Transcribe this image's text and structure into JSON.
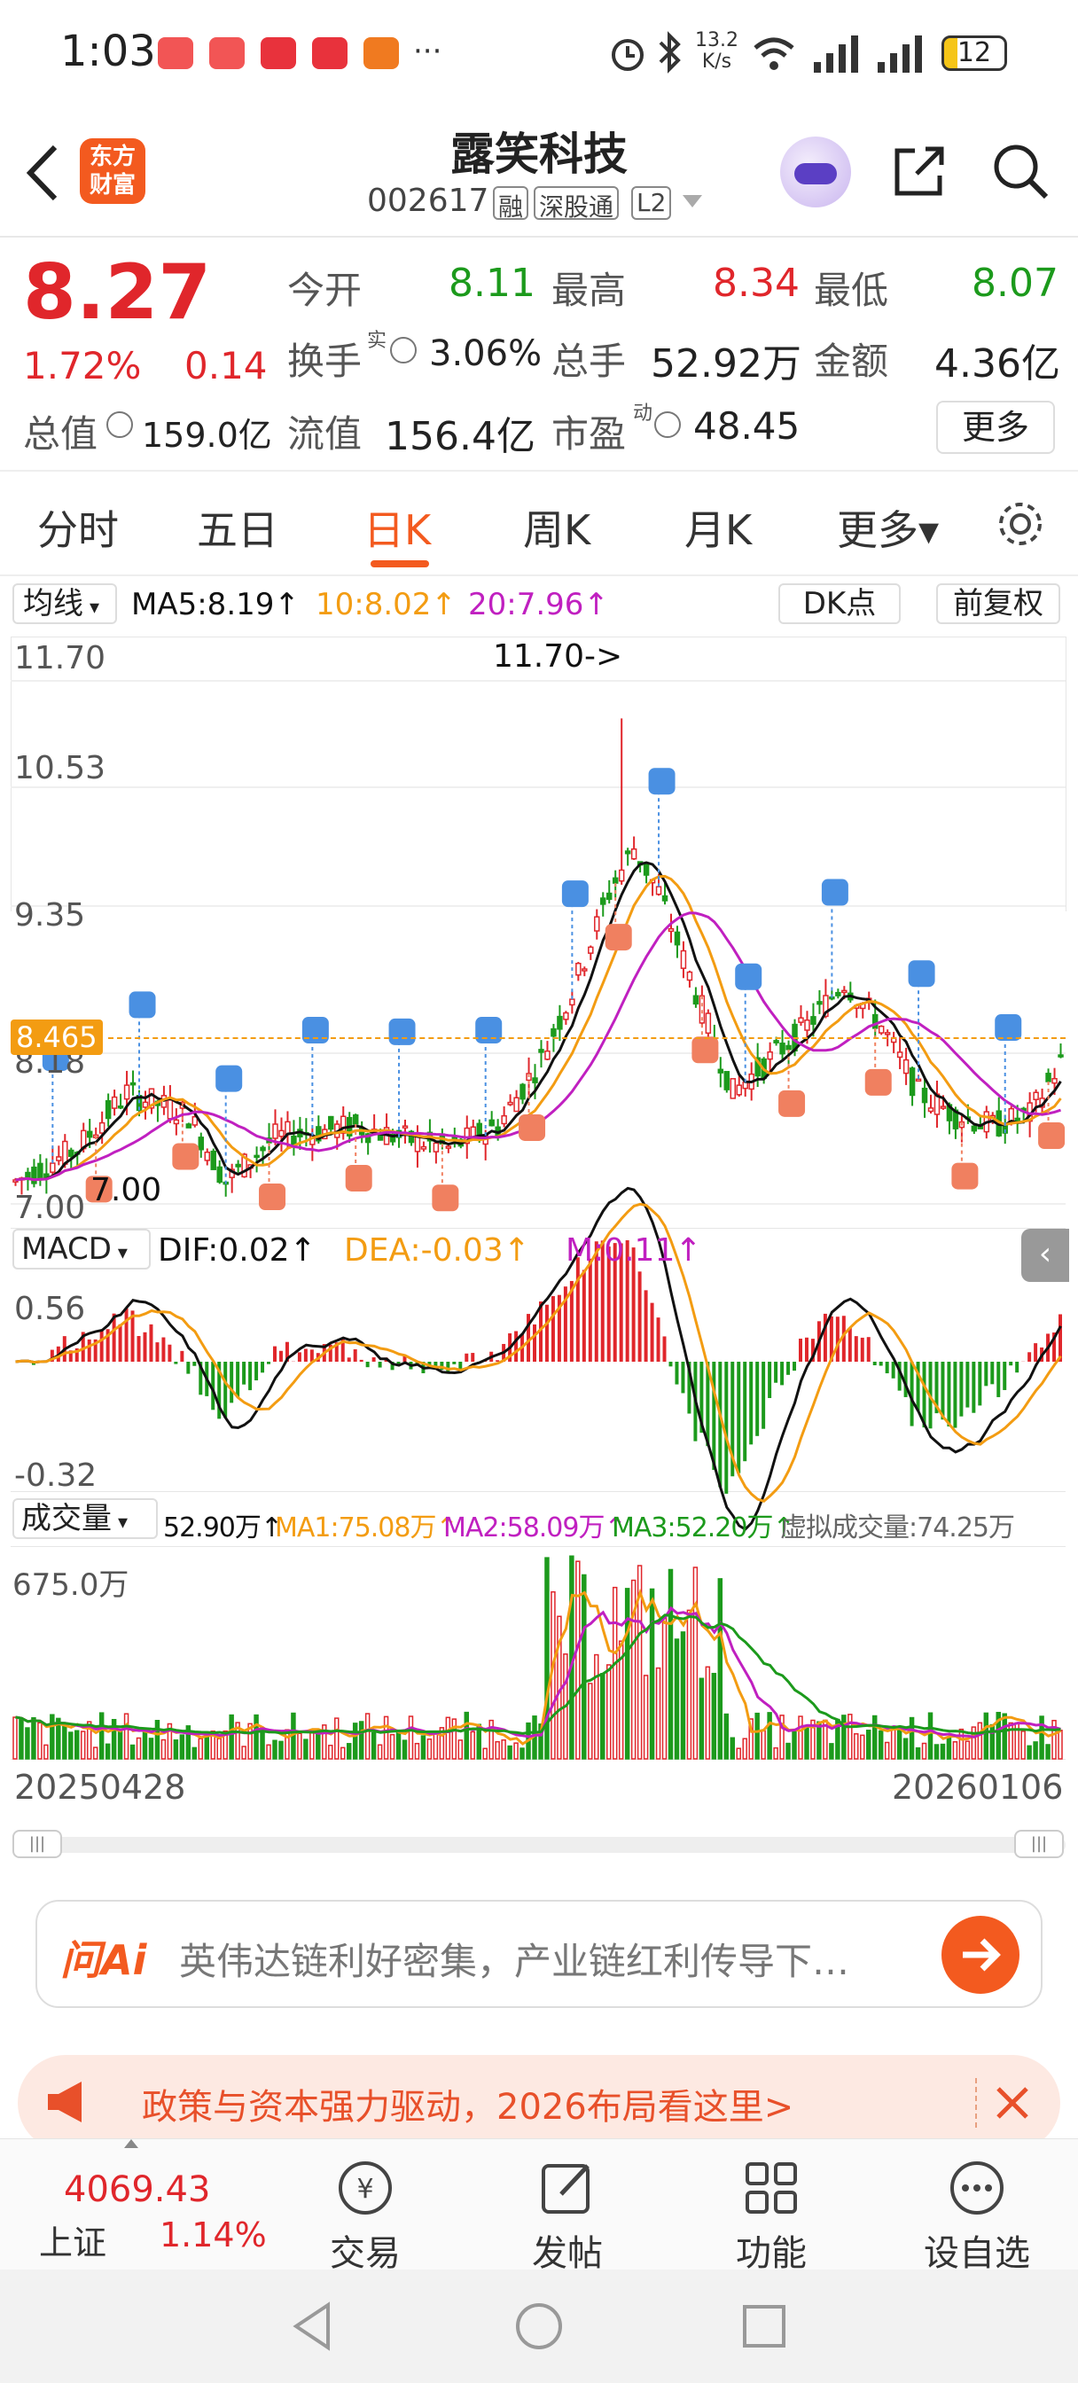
{
  "status": {
    "time": "1:03",
    "net_speed_top": "13.2",
    "net_speed_bottom": "K/s",
    "battery": "12",
    "more": "···"
  },
  "header": {
    "title": "露笑科技",
    "code": "002617",
    "tags": [
      "融",
      "深股通",
      "L2"
    ],
    "logo_line1": "东方",
    "logo_line2": "财富"
  },
  "quote": {
    "price": "8.27",
    "change_pct": "1.72%",
    "change": "0.14",
    "open_label": "今开",
    "open": "8.11",
    "high_label": "最高",
    "high": "8.34",
    "low_label": "最低",
    "low": "8.07",
    "turnover_label": "换手",
    "turnover_sup": "实",
    "turnover": "3.06%",
    "volume_label": "总手",
    "volume": "52.92万",
    "amount_label": "金额",
    "amount": "4.36亿",
    "mktcap_label": "总值",
    "mktcap": "159.0亿",
    "float_label": "流值",
    "float": "156.4亿",
    "pe_label": "市盈",
    "pe_sup": "动",
    "pe": "48.45",
    "more_btn": "更多"
  },
  "tabs": [
    "分时",
    "五日",
    "日K",
    "周K",
    "月K",
    "更多▾"
  ],
  "active_tab": "日K",
  "chart": {
    "ma_selector": "均线",
    "ma5": "MA5:8.19↑",
    "ma10": "10:8.02↑",
    "ma20": "20:7.96↑",
    "dk_btn": "DK点",
    "fq_btn": "前复权",
    "y_labels": [
      "11.70",
      "10.53",
      "9.35",
      "8.18",
      "7.00"
    ],
    "max_mark": "11.70->",
    "min_mark": "7.00",
    "current_price_tag": "8.465",
    "macd_selector": "MACD",
    "dif": "DIF:0.02↑",
    "dea": "DEA:-0.03↑",
    "m": "M:0.11↑",
    "macd_top": "0.56",
    "macd_bottom": "-0.32",
    "vol_selector": "成交量",
    "vol_cur": "52.90万↑",
    "vol_ma1": "MA1:75.08万↑",
    "vol_ma2": "MA2:58.09万↑",
    "vol_ma3": "MA3:52.20万↑",
    "vol_virtual": "虚拟成交量:74.25万",
    "vol_top": "675.0万",
    "date_start": "20250428",
    "date_end": "20260106",
    "colors": {
      "up": "#e0262b",
      "down": "#1c9a1c",
      "ma5": "#111111",
      "ma10": "#f39c12",
      "ma20": "#c020c0",
      "buy": "#f08060",
      "sell": "#4a90e2"
    }
  },
  "ask": {
    "label": "问Ai",
    "text": "英伟达链利好密集，产业链红利传导下…"
  },
  "banner": {
    "text": "政策与资本强力驱动，2026布局看这里>"
  },
  "bottom_nav": {
    "index_value": "4069.43",
    "index_name": "上证",
    "index_pct": "1.14%",
    "items": [
      "交易",
      "发帖",
      "功能",
      "设自选"
    ]
  }
}
